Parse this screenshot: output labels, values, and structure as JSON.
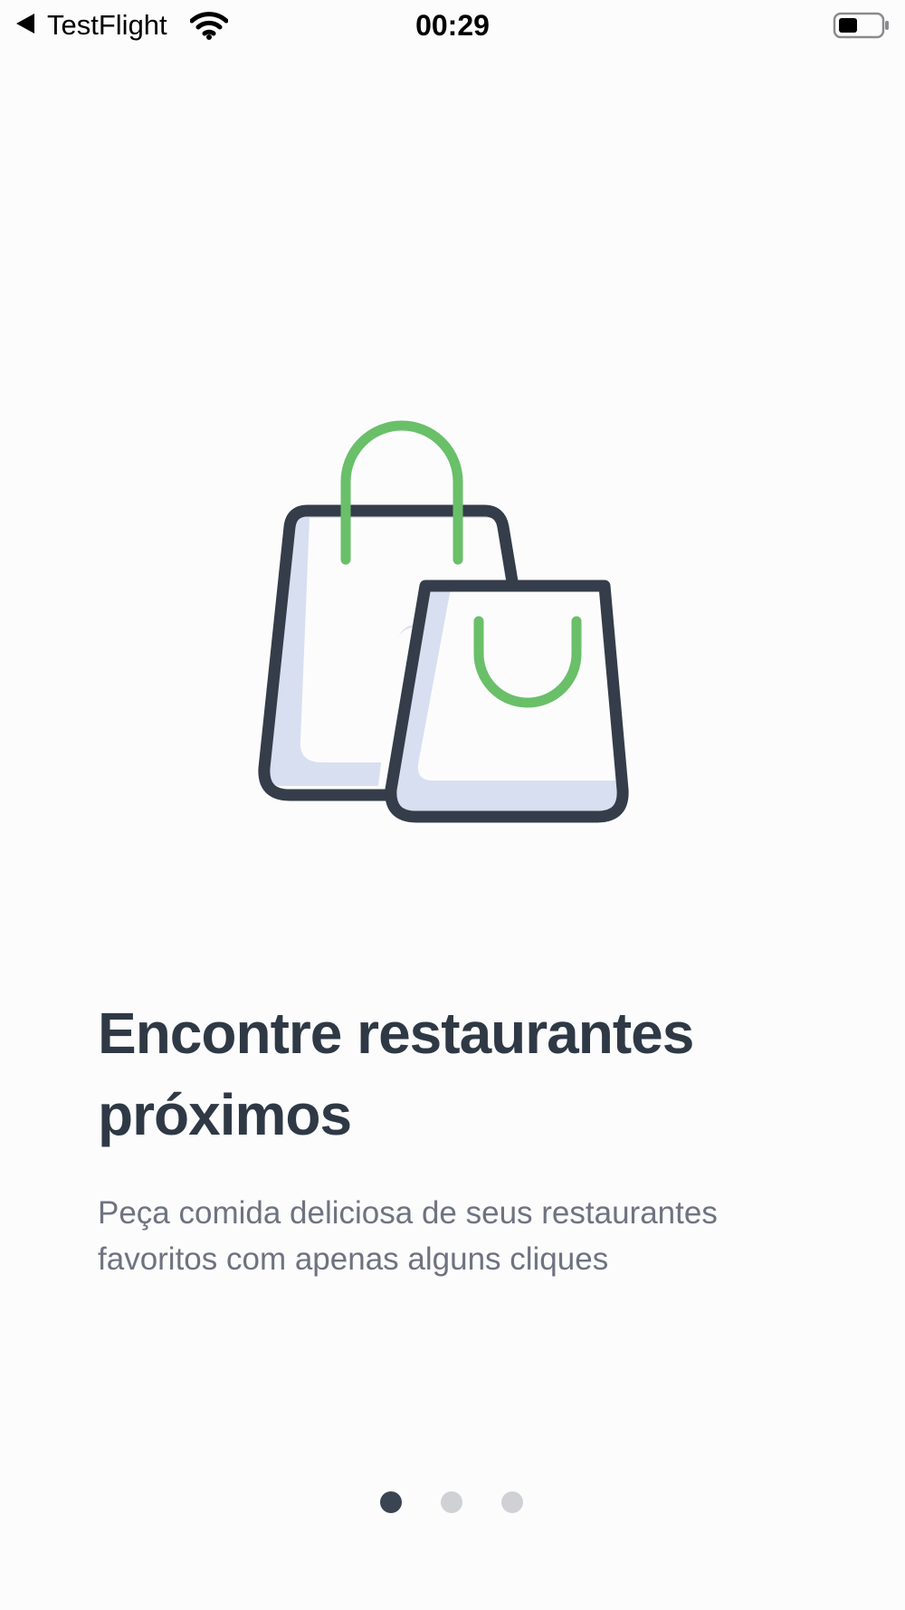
{
  "status_bar": {
    "back_app_label": "TestFlight",
    "time": "00:29",
    "icons": [
      "back-arrow-icon",
      "wifi-icon",
      "battery-icon"
    ]
  },
  "onboarding": {
    "illustration": "shopping-bags-icon",
    "title": "Encontre restaurantes próximos",
    "subtitle": "Peça comida deliciosa de seus restaurantes favoritos com apenas alguns cliques",
    "pager": {
      "total_pages": 3,
      "current_page": 1
    }
  },
  "colors": {
    "background": "#fcfcfd",
    "outline": "#343d49",
    "handle_green": "#6abf69",
    "bag_fill": "#d8dff0",
    "title_text": "#2f3945",
    "subtitle_text": "#6f7380",
    "dot_active": "#3a4452",
    "dot_inactive": "#d0d1d5"
  }
}
